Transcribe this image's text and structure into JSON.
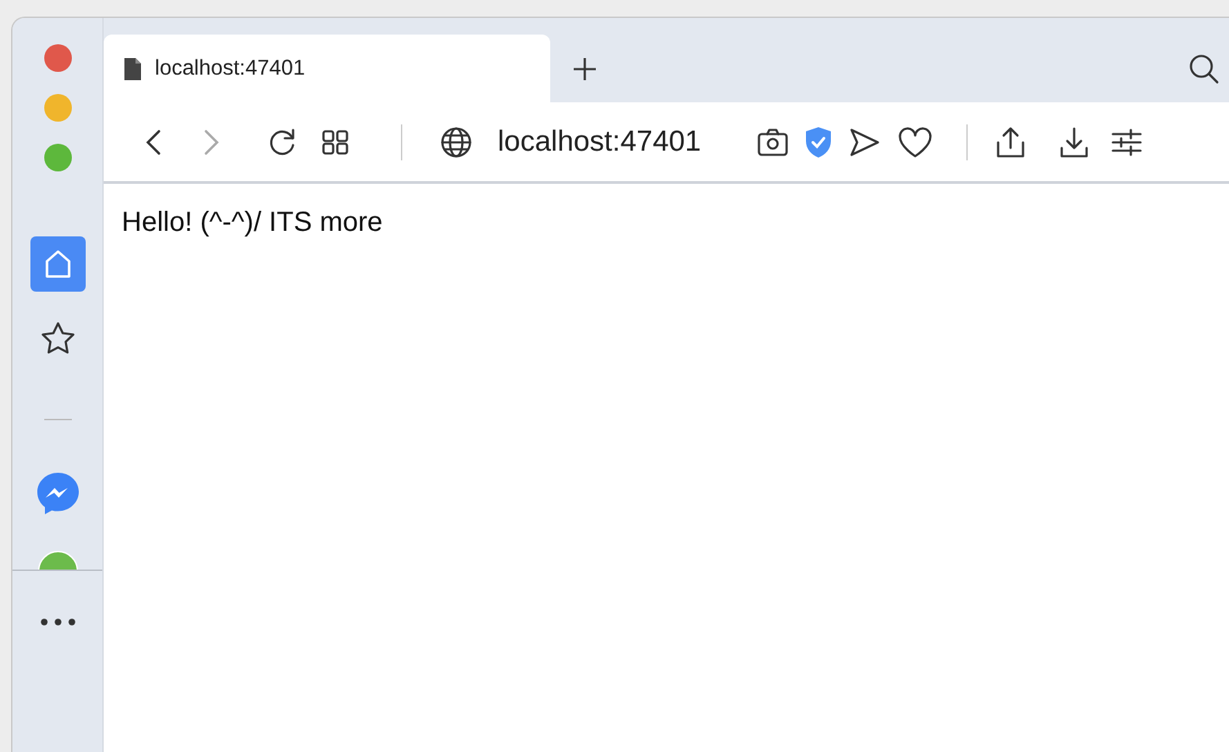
{
  "tabs": [
    {
      "title": "localhost:47401",
      "selected": true
    }
  ],
  "navigation": {
    "back_disabled": false,
    "forward_disabled": true
  },
  "address_bar": {
    "url": "localhost:47401"
  },
  "sidebar": {
    "items": [
      {
        "kind": "home",
        "selected": true
      },
      {
        "kind": "star",
        "selected": false
      }
    ]
  },
  "page": {
    "text": "Hello! (^-^)/ ITS more"
  }
}
